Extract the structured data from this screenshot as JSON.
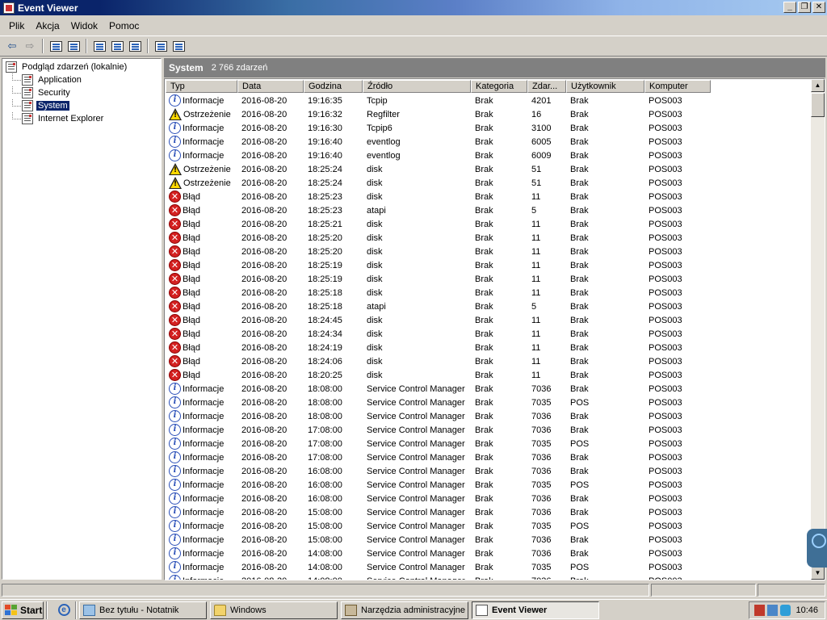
{
  "window": {
    "title": "Event Viewer"
  },
  "menu": [
    "Plik",
    "Akcja",
    "Widok",
    "Pomoc"
  ],
  "tree": {
    "root": "Podgląd zdarzeń (lokalnie)",
    "children": [
      "Application",
      "Security",
      "System",
      "Internet Explorer"
    ],
    "selected": "System"
  },
  "header": {
    "title": "System",
    "count": "2 766 zdarzeń"
  },
  "columns": [
    "Typ",
    "Data",
    "Godzina",
    "Źródło",
    "Kategoria",
    "Zdar...",
    "Użytkownik",
    "Komputer"
  ],
  "events": [
    {
      "type": "info",
      "typ": "Informacje",
      "data": "2016-08-20",
      "godzina": "19:16:35",
      "zrodlo": "Tcpip",
      "kategoria": "Brak",
      "zdarzenie": "4201",
      "uzytkownik": "Brak",
      "komputer": "POS003"
    },
    {
      "type": "warn",
      "typ": "Ostrzeżenie",
      "data": "2016-08-20",
      "godzina": "19:16:32",
      "zrodlo": "Regfilter",
      "kategoria": "Brak",
      "zdarzenie": "16",
      "uzytkownik": "Brak",
      "komputer": "POS003"
    },
    {
      "type": "info",
      "typ": "Informacje",
      "data": "2016-08-20",
      "godzina": "19:16:30",
      "zrodlo": "Tcpip6",
      "kategoria": "Brak",
      "zdarzenie": "3100",
      "uzytkownik": "Brak",
      "komputer": "POS003"
    },
    {
      "type": "info",
      "typ": "Informacje",
      "data": "2016-08-20",
      "godzina": "19:16:40",
      "zrodlo": "eventlog",
      "kategoria": "Brak",
      "zdarzenie": "6005",
      "uzytkownik": "Brak",
      "komputer": "POS003"
    },
    {
      "type": "info",
      "typ": "Informacje",
      "data": "2016-08-20",
      "godzina": "19:16:40",
      "zrodlo": "eventlog",
      "kategoria": "Brak",
      "zdarzenie": "6009",
      "uzytkownik": "Brak",
      "komputer": "POS003"
    },
    {
      "type": "warn",
      "typ": "Ostrzeżenie",
      "data": "2016-08-20",
      "godzina": "18:25:24",
      "zrodlo": "disk",
      "kategoria": "Brak",
      "zdarzenie": "51",
      "uzytkownik": "Brak",
      "komputer": "POS003"
    },
    {
      "type": "warn",
      "typ": "Ostrzeżenie",
      "data": "2016-08-20",
      "godzina": "18:25:24",
      "zrodlo": "disk",
      "kategoria": "Brak",
      "zdarzenie": "51",
      "uzytkownik": "Brak",
      "komputer": "POS003"
    },
    {
      "type": "error",
      "typ": "Błąd",
      "data": "2016-08-20",
      "godzina": "18:25:23",
      "zrodlo": "disk",
      "kategoria": "Brak",
      "zdarzenie": "11",
      "uzytkownik": "Brak",
      "komputer": "POS003"
    },
    {
      "type": "error",
      "typ": "Błąd",
      "data": "2016-08-20",
      "godzina": "18:25:23",
      "zrodlo": "atapi",
      "kategoria": "Brak",
      "zdarzenie": "5",
      "uzytkownik": "Brak",
      "komputer": "POS003"
    },
    {
      "type": "error",
      "typ": "Błąd",
      "data": "2016-08-20",
      "godzina": "18:25:21",
      "zrodlo": "disk",
      "kategoria": "Brak",
      "zdarzenie": "11",
      "uzytkownik": "Brak",
      "komputer": "POS003"
    },
    {
      "type": "error",
      "typ": "Błąd",
      "data": "2016-08-20",
      "godzina": "18:25:20",
      "zrodlo": "disk",
      "kategoria": "Brak",
      "zdarzenie": "11",
      "uzytkownik": "Brak",
      "komputer": "POS003"
    },
    {
      "type": "error",
      "typ": "Błąd",
      "data": "2016-08-20",
      "godzina": "18:25:20",
      "zrodlo": "disk",
      "kategoria": "Brak",
      "zdarzenie": "11",
      "uzytkownik": "Brak",
      "komputer": "POS003"
    },
    {
      "type": "error",
      "typ": "Błąd",
      "data": "2016-08-20",
      "godzina": "18:25:19",
      "zrodlo": "disk",
      "kategoria": "Brak",
      "zdarzenie": "11",
      "uzytkownik": "Brak",
      "komputer": "POS003"
    },
    {
      "type": "error",
      "typ": "Błąd",
      "data": "2016-08-20",
      "godzina": "18:25:19",
      "zrodlo": "disk",
      "kategoria": "Brak",
      "zdarzenie": "11",
      "uzytkownik": "Brak",
      "komputer": "POS003"
    },
    {
      "type": "error",
      "typ": "Błąd",
      "data": "2016-08-20",
      "godzina": "18:25:18",
      "zrodlo": "disk",
      "kategoria": "Brak",
      "zdarzenie": "11",
      "uzytkownik": "Brak",
      "komputer": "POS003"
    },
    {
      "type": "error",
      "typ": "Błąd",
      "data": "2016-08-20",
      "godzina": "18:25:18",
      "zrodlo": "atapi",
      "kategoria": "Brak",
      "zdarzenie": "5",
      "uzytkownik": "Brak",
      "komputer": "POS003"
    },
    {
      "type": "error",
      "typ": "Błąd",
      "data": "2016-08-20",
      "godzina": "18:24:45",
      "zrodlo": "disk",
      "kategoria": "Brak",
      "zdarzenie": "11",
      "uzytkownik": "Brak",
      "komputer": "POS003"
    },
    {
      "type": "error",
      "typ": "Błąd",
      "data": "2016-08-20",
      "godzina": "18:24:34",
      "zrodlo": "disk",
      "kategoria": "Brak",
      "zdarzenie": "11",
      "uzytkownik": "Brak",
      "komputer": "POS003"
    },
    {
      "type": "error",
      "typ": "Błąd",
      "data": "2016-08-20",
      "godzina": "18:24:19",
      "zrodlo": "disk",
      "kategoria": "Brak",
      "zdarzenie": "11",
      "uzytkownik": "Brak",
      "komputer": "POS003"
    },
    {
      "type": "error",
      "typ": "Błąd",
      "data": "2016-08-20",
      "godzina": "18:24:06",
      "zrodlo": "disk",
      "kategoria": "Brak",
      "zdarzenie": "11",
      "uzytkownik": "Brak",
      "komputer": "POS003"
    },
    {
      "type": "error",
      "typ": "Błąd",
      "data": "2016-08-20",
      "godzina": "18:20:25",
      "zrodlo": "disk",
      "kategoria": "Brak",
      "zdarzenie": "11",
      "uzytkownik": "Brak",
      "komputer": "POS003"
    },
    {
      "type": "info",
      "typ": "Informacje",
      "data": "2016-08-20",
      "godzina": "18:08:00",
      "zrodlo": "Service Control Manager",
      "kategoria": "Brak",
      "zdarzenie": "7036",
      "uzytkownik": "Brak",
      "komputer": "POS003"
    },
    {
      "type": "info",
      "typ": "Informacje",
      "data": "2016-08-20",
      "godzina": "18:08:00",
      "zrodlo": "Service Control Manager",
      "kategoria": "Brak",
      "zdarzenie": "7035",
      "uzytkownik": "POS",
      "komputer": "POS003"
    },
    {
      "type": "info",
      "typ": "Informacje",
      "data": "2016-08-20",
      "godzina": "18:08:00",
      "zrodlo": "Service Control Manager",
      "kategoria": "Brak",
      "zdarzenie": "7036",
      "uzytkownik": "Brak",
      "komputer": "POS003"
    },
    {
      "type": "info",
      "typ": "Informacje",
      "data": "2016-08-20",
      "godzina": "17:08:00",
      "zrodlo": "Service Control Manager",
      "kategoria": "Brak",
      "zdarzenie": "7036",
      "uzytkownik": "Brak",
      "komputer": "POS003"
    },
    {
      "type": "info",
      "typ": "Informacje",
      "data": "2016-08-20",
      "godzina": "17:08:00",
      "zrodlo": "Service Control Manager",
      "kategoria": "Brak",
      "zdarzenie": "7035",
      "uzytkownik": "POS",
      "komputer": "POS003"
    },
    {
      "type": "info",
      "typ": "Informacje",
      "data": "2016-08-20",
      "godzina": "17:08:00",
      "zrodlo": "Service Control Manager",
      "kategoria": "Brak",
      "zdarzenie": "7036",
      "uzytkownik": "Brak",
      "komputer": "POS003"
    },
    {
      "type": "info",
      "typ": "Informacje",
      "data": "2016-08-20",
      "godzina": "16:08:00",
      "zrodlo": "Service Control Manager",
      "kategoria": "Brak",
      "zdarzenie": "7036",
      "uzytkownik": "Brak",
      "komputer": "POS003"
    },
    {
      "type": "info",
      "typ": "Informacje",
      "data": "2016-08-20",
      "godzina": "16:08:00",
      "zrodlo": "Service Control Manager",
      "kategoria": "Brak",
      "zdarzenie": "7035",
      "uzytkownik": "POS",
      "komputer": "POS003"
    },
    {
      "type": "info",
      "typ": "Informacje",
      "data": "2016-08-20",
      "godzina": "16:08:00",
      "zrodlo": "Service Control Manager",
      "kategoria": "Brak",
      "zdarzenie": "7036",
      "uzytkownik": "Brak",
      "komputer": "POS003"
    },
    {
      "type": "info",
      "typ": "Informacje",
      "data": "2016-08-20",
      "godzina": "15:08:00",
      "zrodlo": "Service Control Manager",
      "kategoria": "Brak",
      "zdarzenie": "7036",
      "uzytkownik": "Brak",
      "komputer": "POS003"
    },
    {
      "type": "info",
      "typ": "Informacje",
      "data": "2016-08-20",
      "godzina": "15:08:00",
      "zrodlo": "Service Control Manager",
      "kategoria": "Brak",
      "zdarzenie": "7035",
      "uzytkownik": "POS",
      "komputer": "POS003"
    },
    {
      "type": "info",
      "typ": "Informacje",
      "data": "2016-08-20",
      "godzina": "15:08:00",
      "zrodlo": "Service Control Manager",
      "kategoria": "Brak",
      "zdarzenie": "7036",
      "uzytkownik": "Brak",
      "komputer": "POS003"
    },
    {
      "type": "info",
      "typ": "Informacje",
      "data": "2016-08-20",
      "godzina": "14:08:00",
      "zrodlo": "Service Control Manager",
      "kategoria": "Brak",
      "zdarzenie": "7036",
      "uzytkownik": "Brak",
      "komputer": "POS003"
    },
    {
      "type": "info",
      "typ": "Informacje",
      "data": "2016-08-20",
      "godzina": "14:08:00",
      "zrodlo": "Service Control Manager",
      "kategoria": "Brak",
      "zdarzenie": "7035",
      "uzytkownik": "POS",
      "komputer": "POS003"
    },
    {
      "type": "info",
      "typ": "Informacje",
      "data": "2016-08-20",
      "godzina": "14:08:00",
      "zrodlo": "Service Control Manager",
      "kategoria": "Brak",
      "zdarzenie": "7036",
      "uzytkownik": "Brak",
      "komputer": "POS003"
    }
  ],
  "taskbar": {
    "start": "Start",
    "tasks": [
      "Bez tytułu - Notatnik",
      "Windows",
      "Narzędzia administracyjne",
      "Event Viewer"
    ],
    "active_task": "Event Viewer",
    "clock": "10:46"
  },
  "colors": {
    "selection": "#0a246a",
    "header_bar": "#808080",
    "face": "#d4d0c8"
  },
  "icons": {
    "info": "info-icon",
    "warn": "warning-icon",
    "error": "error-icon"
  }
}
